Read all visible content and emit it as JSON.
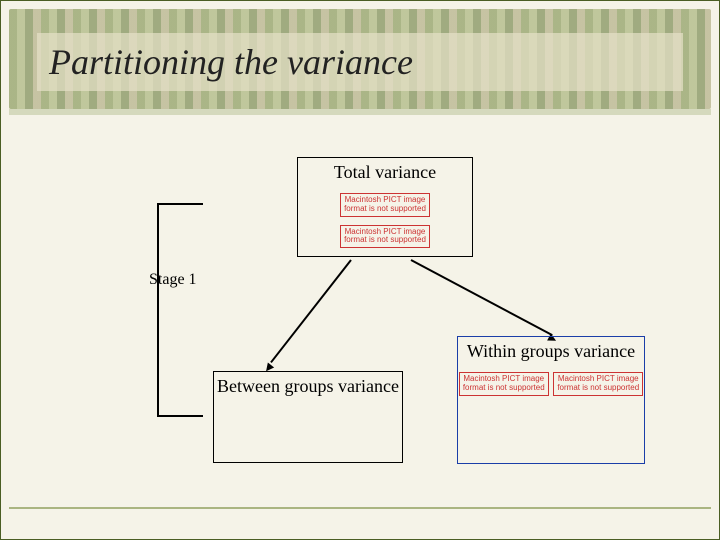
{
  "title": "Partitioning the variance",
  "stage_label": "Stage 1",
  "boxes": {
    "total": "Total variance",
    "between": "Between groups variance",
    "within": "Within groups variance"
  },
  "pict_error": "Macintosh PICT image format is not supported",
  "colors": {
    "within_border": "#1a3da8",
    "band": "#7a8c3c"
  }
}
